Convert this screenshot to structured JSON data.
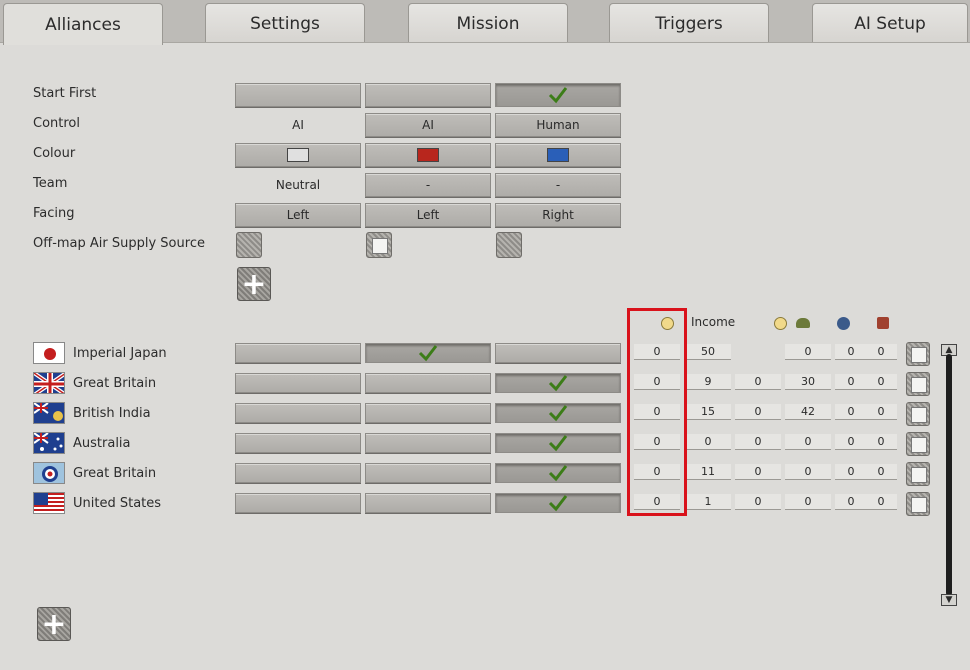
{
  "tabs": [
    "Alliances",
    "Settings",
    "Mission",
    "Triggers",
    "AI Setup"
  ],
  "settings": {
    "start_first": "Start First",
    "control": "Control",
    "colour": "Colour",
    "team": "Team",
    "facing": "Facing",
    "air_supply": "Off-map Air Supply Source"
  },
  "columns": [
    {
      "control": "AI",
      "team": "Neutral",
      "facing": "Left",
      "colour": "#e0e0e0",
      "start_first": false
    },
    {
      "control": "AI",
      "team": "-",
      "facing": "Left",
      "colour": "#b8261d",
      "start_first": false
    },
    {
      "control": "Human",
      "team": "-",
      "facing": "Right",
      "colour": "#2a5fb8",
      "start_first": true
    }
  ],
  "income_header": "Income",
  "nations": [
    {
      "name": "Imperial Japan",
      "flag": "japan",
      "alliance": 1,
      "values": [
        "0",
        "50",
        "",
        "0",
        "0",
        "0"
      ]
    },
    {
      "name": "Great Britain",
      "flag": "uk",
      "alliance": 2,
      "values": [
        "0",
        "9",
        "0",
        "30",
        "0",
        "0"
      ]
    },
    {
      "name": "British India",
      "flag": "india",
      "alliance": 2,
      "values": [
        "0",
        "15",
        "0",
        "42",
        "0",
        "0"
      ]
    },
    {
      "name": "Australia",
      "flag": "australia",
      "alliance": 2,
      "values": [
        "0",
        "0",
        "0",
        "0",
        "0",
        "0"
      ]
    },
    {
      "name": "Great Britain",
      "flag": "raf",
      "alliance": 2,
      "values": [
        "0",
        "11",
        "0",
        "0",
        "0",
        "0"
      ]
    },
    {
      "name": "United States",
      "flag": "us",
      "alliance": 2,
      "values": [
        "0",
        "1",
        "0",
        "0",
        "0",
        "0"
      ]
    }
  ],
  "accent": "#d9121b"
}
